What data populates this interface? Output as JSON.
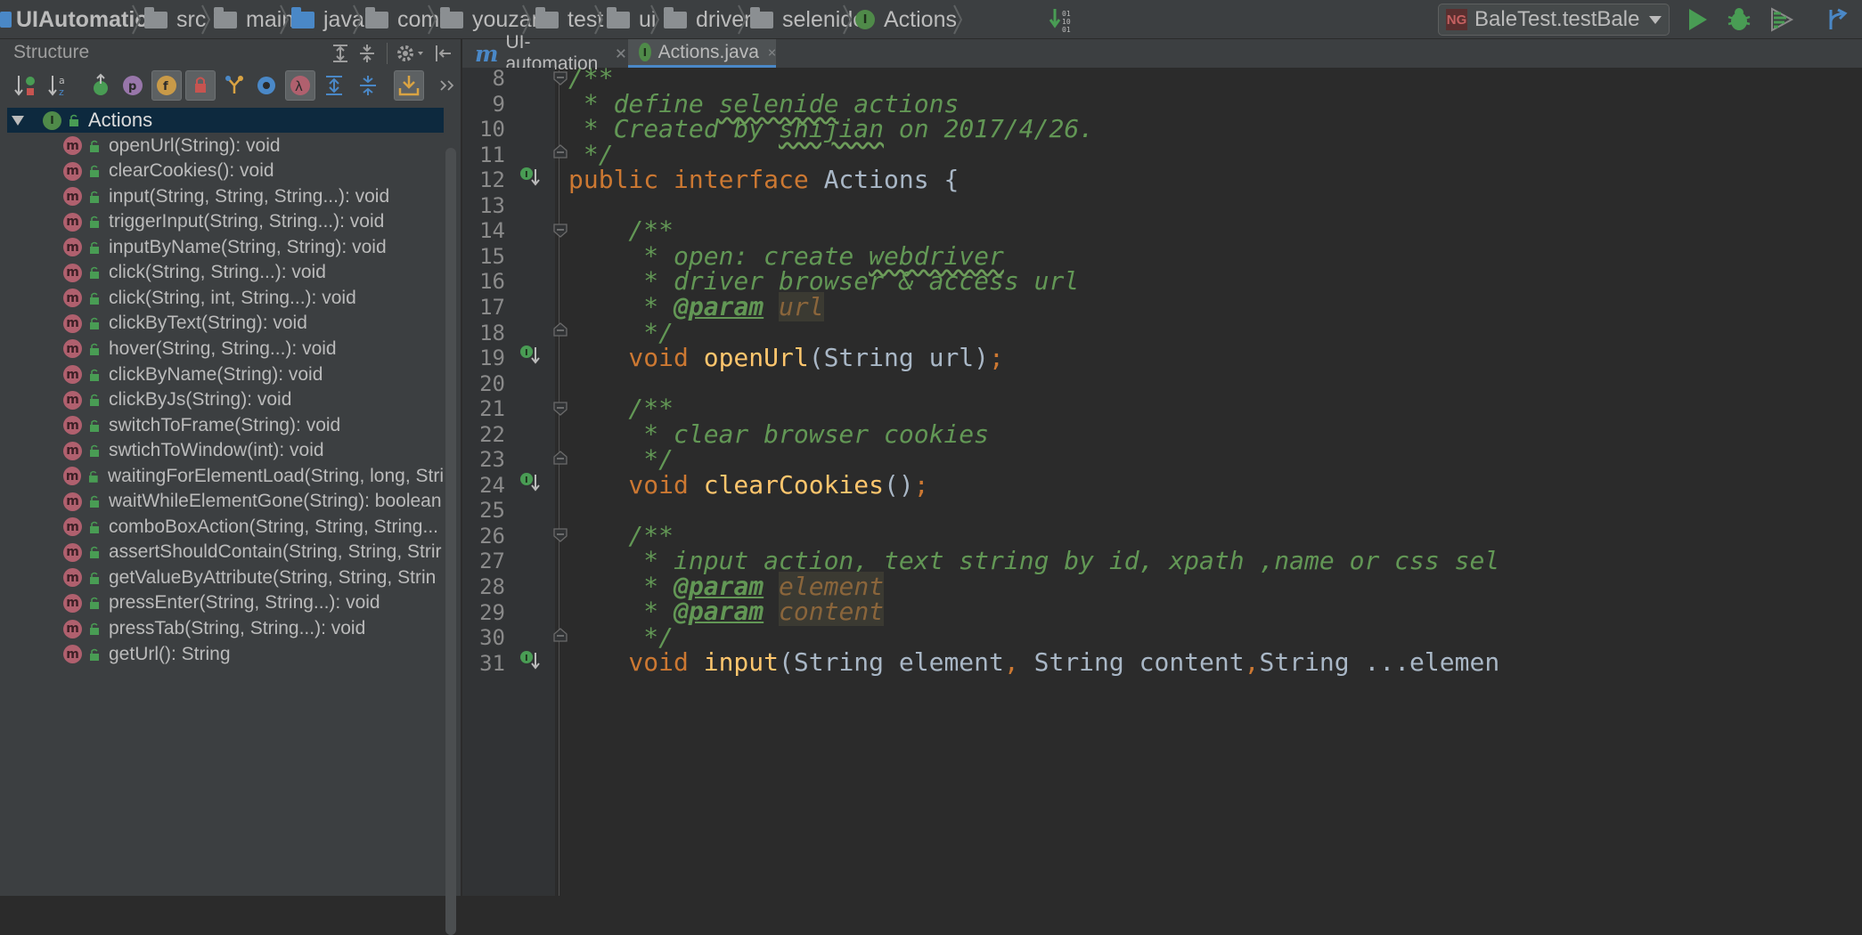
{
  "breadcrumb": {
    "project": "UIAutomation",
    "items": [
      "src",
      "main",
      "java",
      "com",
      "youzan",
      "test",
      "ui",
      "driver",
      "selenide"
    ],
    "file": "Actions"
  },
  "toolbar": {
    "run_config": "BaleTest.testBale",
    "run_config_icon_text": "NG"
  },
  "structure": {
    "title": "Structure",
    "root": "Actions",
    "root_badge": "I",
    "method_badge": "m",
    "members": [
      "openUrl(String): void",
      "clearCookies(): void",
      "input(String, String, String...): void",
      "triggerInput(String, String...): void",
      "inputByName(String, String): void",
      "click(String, String...): void",
      "click(String, int, String...): void",
      "clickByText(String): void",
      "hover(String, String...): void",
      "clickByName(String): void",
      "clickByJs(String): void",
      "switchToFrame(String): void",
      "swtichToWindow(int): void",
      "waitingForElementLoad(String, long, Stri",
      "waitWhileElementGone(String): boolean",
      "comboBoxAction(String, String, String...",
      "assertShouldContain(String, String, Strir",
      "getValueByAttribute(String, String, Strin",
      "pressEnter(String, String...): void",
      "pressTab(String, String...): void",
      "getUrl(): String"
    ]
  },
  "tabs": [
    {
      "label": "UI-automation",
      "icon": "m"
    },
    {
      "label": "Actions.java",
      "icon": "I"
    }
  ],
  "editor": {
    "line_numbers": [
      "8",
      "9",
      "10",
      "11",
      "12",
      "13",
      "14",
      "15",
      "16",
      "17",
      "18",
      "19",
      "20",
      "21",
      "22",
      "23",
      "24",
      "25",
      "26",
      "27",
      "28",
      "29",
      "30",
      "31"
    ],
    "code": {
      "l8": "/**",
      "l9a": " * define ",
      "l9b": "selenide",
      "l9c": " actions",
      "l10a": " * Created by ",
      "l10b": "shijian",
      "l10c": " on 2017/4/26.",
      "l11": " */",
      "l12a": "public interface ",
      "l12b": "Actions {",
      "l14": "    /**",
      "l15a": "     * open: create ",
      "l15b": "webdriver",
      "l16": "     * driver browser & access url",
      "l17a": "     * ",
      "l17b": "@param",
      "l17c": " ",
      "l17d": "url",
      "l18": "     */",
      "l19a": "    void ",
      "l19b": "openUrl",
      "l19c": "(String url)",
      "l19d": ";",
      "l21": "    /**",
      "l22": "     * clear browser cookies",
      "l23": "     */",
      "l24a": "    void ",
      "l24b": "clearCookies",
      "l24c": "()",
      "l24d": ";",
      "l26": "    /**",
      "l27": "     * input action, text string by id, xpath ,name or css sel",
      "l28a": "     * ",
      "l28b": "@param",
      "l28c": " ",
      "l28d": "element",
      "l29a": "     * ",
      "l29b": "@param",
      "l29c": " ",
      "l29d": "content",
      "l30": "     */",
      "l31a": "    void ",
      "l31b": "input",
      "l31c": "(String element",
      "l31d": ", ",
      "l31e": "String content",
      "l31f": ",",
      "l31g": "String ...elemen"
    }
  }
}
